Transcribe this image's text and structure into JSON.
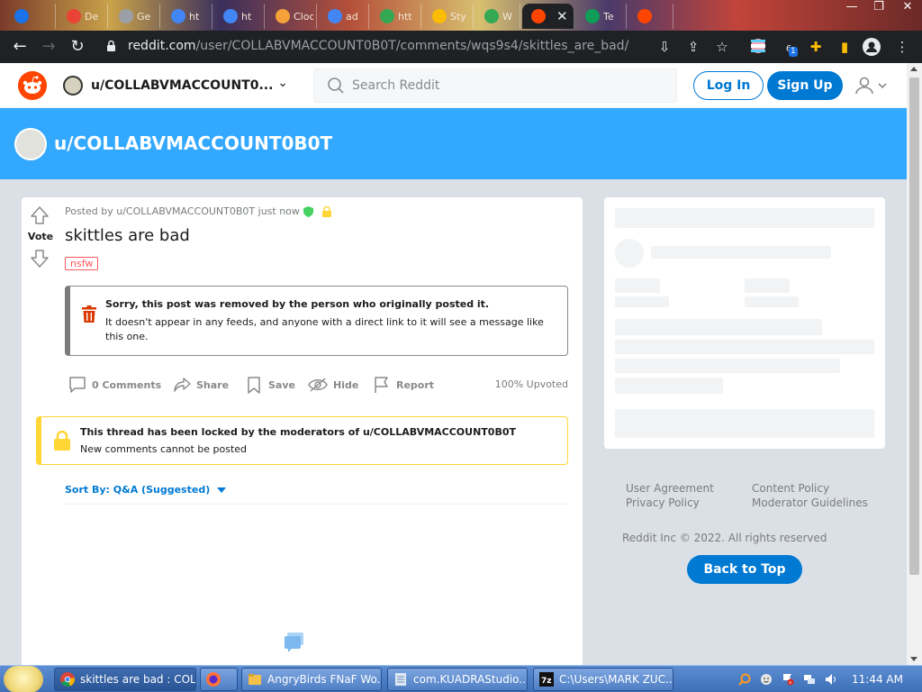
{
  "browser": {
    "tabs": [
      {
        "title": "",
        "favicon_color": "#1a73e8"
      },
      {
        "title": "De",
        "favicon_color": "#ea4335"
      },
      {
        "title": "Ge",
        "favicon_color": "#9aa0a6"
      },
      {
        "title": "ht",
        "favicon_color": "#4285f4"
      },
      {
        "title": "ht",
        "favicon_color": "#4285f4"
      },
      {
        "title": "Clock",
        "favicon_color": "#f4a13a"
      },
      {
        "title": "ad",
        "favicon_color": "#4285f4"
      },
      {
        "title": "htt",
        "favicon_color": "#34a853"
      },
      {
        "title": "Sty",
        "favicon_color": "#fbbc04"
      },
      {
        "title": "W",
        "favicon_color": "#34a853"
      },
      {
        "title": "",
        "favicon_color": "#ff4500"
      },
      {
        "title": "Te",
        "favicon_color": "#0f9d58"
      },
      {
        "title": "",
        "favicon_color": "#ff4500"
      }
    ],
    "url_host": "reddit.com",
    "url_path": "/user/COLLABVMACCOUNT0B0T/comments/wqs9s4/skittles_are_bad/",
    "extension_badge": "1"
  },
  "header": {
    "username": "u/COLLABVMACCOUNT0...",
    "search_placeholder": "Search Reddit",
    "login_label": "Log In",
    "signup_label": "Sign Up"
  },
  "banner": {
    "username": "u/COLLABVMACCOUNT0B0T"
  },
  "post": {
    "vote_label": "Vote",
    "meta": "Posted by u/COLLABVMACCOUNT0B0T just now",
    "title": "skittles are bad",
    "tag": "nsfw",
    "removed_heading": "Sorry, this post was removed by the person who originally posted it.",
    "removed_body": "It doesn't appear in any feeds, and anyone with a direct link to it will see a message like this one.",
    "actions": {
      "comments": "0 Comments",
      "share": "Share",
      "save": "Save",
      "hide": "Hide",
      "report": "Report"
    },
    "upvoted": "100% Upvoted",
    "locked_heading": "This thread has been locked by the moderators of u/COLLABVMACCOUNT0B0T",
    "locked_body": "New comments cannot be posted",
    "sort_label": "Sort By: Q&A (Suggested)"
  },
  "sidebar": {
    "links": [
      "User Agreement",
      "Privacy Policy",
      "Content Policy",
      "Moderator Guidelines"
    ],
    "copyright": "Reddit Inc © 2022. All rights reserved",
    "back_to_top": "Back to Top"
  },
  "taskbar": {
    "tasks": [
      "skittles are bad : COL...",
      "",
      "AngryBirds FNaF Wo...",
      "com.KUADRAStudio...",
      "C:\\Users\\MARK ZUC..."
    ],
    "clock": "11:44 AM"
  },
  "colors": {
    "reddit_orange": "#ff4500",
    "reddit_blue": "#0079d3",
    "banner_blue": "#33a8ff",
    "locked_yellow": "#ffd635",
    "nsfw_red": "#ff585b"
  }
}
